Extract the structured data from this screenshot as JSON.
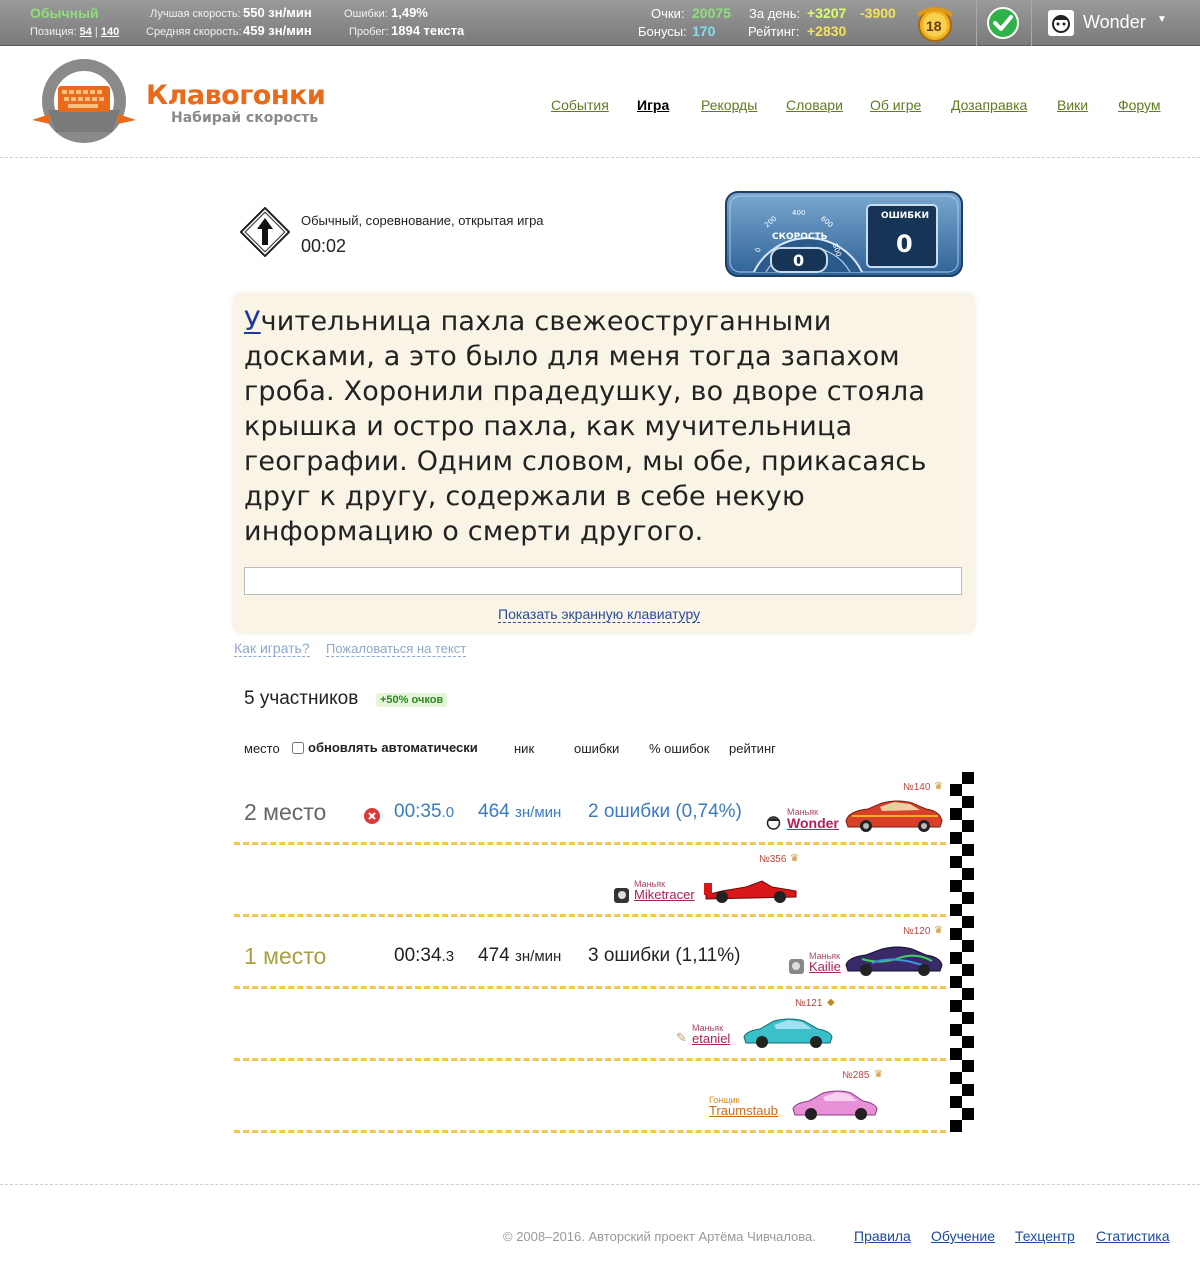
{
  "topbar": {
    "mode": "Обычный",
    "position_label": "Позиция:",
    "position_value": "54",
    "position_total": "140",
    "best_speed_label": "Лучшая скорость:",
    "best_speed_value": "550 зн/мин",
    "avg_speed_label": "Средняя скорость:",
    "avg_speed_value": "459 зн/мин",
    "errors_label": "Ошибки:",
    "errors_value": "1,49%",
    "mileage_label": "Пробег:",
    "mileage_value": "1894 текста",
    "points_label": "Очки:",
    "points_value": "20075",
    "bonus_label": "Бонусы:",
    "bonus_value": "170",
    "day_label": "За день:",
    "day_plus": "+3207",
    "day_minus": "-3900",
    "rating_label": "Рейтинг:",
    "rating_value": "+2830",
    "level": "18",
    "username": "Wonder"
  },
  "header": {
    "logo_title": "Клавогонки",
    "logo_subtitle": "Набирай скорость",
    "nav": [
      "События",
      "Игра",
      "Рекорды",
      "Словари",
      "Об игре",
      "Дозаправка",
      "Вики",
      "Форум"
    ]
  },
  "game": {
    "status": "Обычный, соревнование, открытая игра",
    "timer": "00:02",
    "speedometer_label": "СКОРОСТЬ",
    "speed_value": "0",
    "errors_label": "ОШИБКИ",
    "errors_value": "0",
    "gauge_ticks": [
      "0",
      "200",
      "400",
      "600",
      "800"
    ],
    "text_first_letter": "У",
    "text_rest": "чительница пахла свежеоструганными досками, а это было для меня тогда запахом гроба. Хоронили прадедушку, во дворе стояла крышка и остро пахла, как мучительница географии. Одним словом, мы обе, прикасаясь друг к другу, содержали в себе некую информацию о смерти другого.",
    "input_value": "",
    "show_keyboard": "Показать экранную клавиатуру",
    "how_to_play": "Как играть?",
    "complain": "Пожаловаться на текст"
  },
  "participants": {
    "count_label": "5 участников",
    "bonus_badge": "+50% очков",
    "columns": {
      "place": "место",
      "auto_update": "обновлять автоматически",
      "nick": "ник",
      "errors": "ошибки",
      "error_pct": "% ошибок",
      "rating": "рейтинг"
    },
    "lanes": [
      {
        "place": "2 место",
        "time_main": "00:35",
        "time_frac": ".0",
        "speed": "464",
        "speed_unit": "зн/мин",
        "errors": "2 ошибки (0,74%)",
        "rank": "Маньяк",
        "nick": "Wonder",
        "car_number": "№140",
        "car_color": "#d9402a",
        "accent": "#3a7ac0"
      },
      {
        "place": "",
        "time_main": "",
        "time_frac": "",
        "speed": "",
        "speed_unit": "",
        "errors": "",
        "rank": "Маньяк",
        "nick": "Miketracer",
        "car_number": "№356",
        "car_color": "#d81818",
        "accent": "#222"
      },
      {
        "place": "1 место",
        "time_main": "00:34",
        "time_frac": ".3",
        "speed": "474",
        "speed_unit": "зн/мин",
        "errors": "3 ошибки (1,11%)",
        "rank": "Маньяк",
        "nick": "Kailie",
        "car_number": "№120",
        "car_color": "#3a2a6a",
        "accent": "#222"
      },
      {
        "place": "",
        "time_main": "",
        "time_frac": "",
        "speed": "",
        "speed_unit": "",
        "errors": "",
        "rank": "Маньяк",
        "nick": "etaniel",
        "car_number": "№121",
        "car_color": "#3ac0c8",
        "accent": "#222"
      },
      {
        "place": "",
        "time_main": "",
        "time_frac": "",
        "speed": "",
        "speed_unit": "",
        "errors": "",
        "rank": "Гонщик",
        "nick": "Traumstaub",
        "car_number": "№285",
        "car_color": "#e890d8",
        "accent": "#222"
      }
    ]
  },
  "footer": {
    "copyright": "© 2008–2016. Авторский проект Артёма Чивчалова.",
    "links": [
      "Правила",
      "Обучение",
      "Техцентр",
      "Статистика"
    ]
  }
}
